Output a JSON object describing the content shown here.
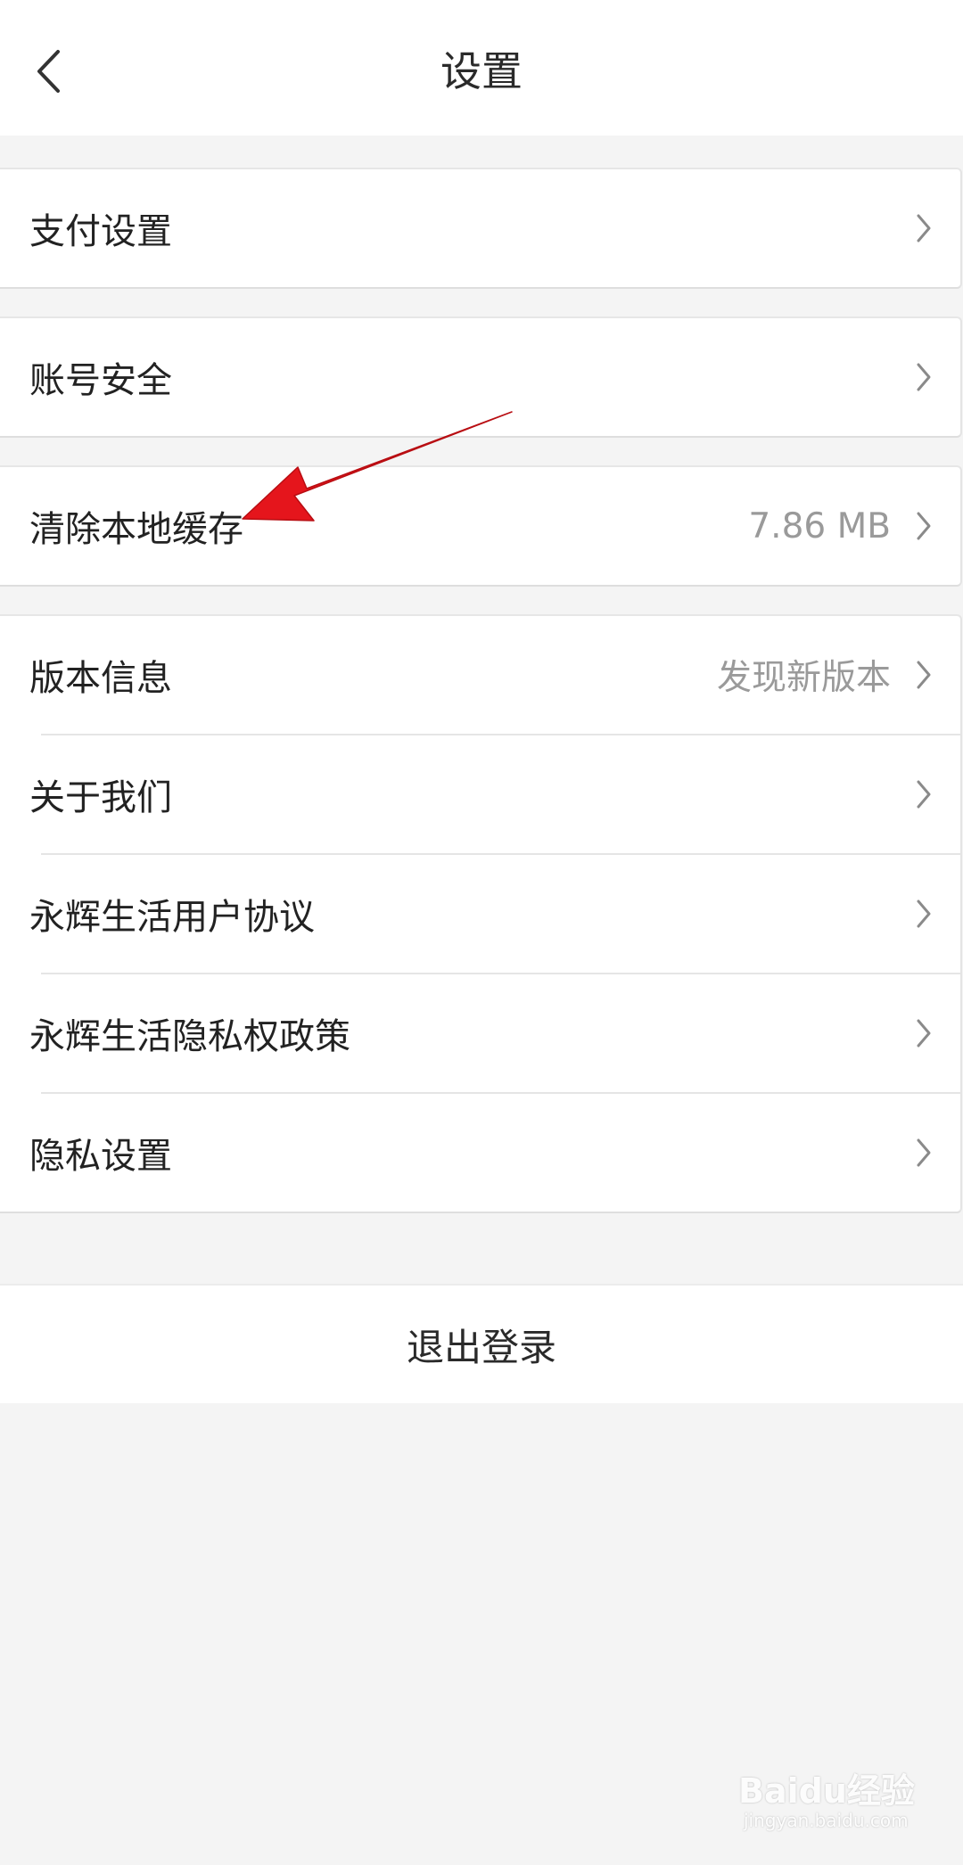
{
  "header": {
    "title": "设置",
    "back_icon": "chevron-left-icon"
  },
  "groups": [
    {
      "items": [
        {
          "label": "支付设置",
          "value": ""
        }
      ]
    },
    {
      "items": [
        {
          "label": "账号安全",
          "value": ""
        }
      ]
    },
    {
      "items": [
        {
          "label": "清除本地缓存",
          "value": "7.86 MB"
        }
      ]
    },
    {
      "items": [
        {
          "label": "版本信息",
          "value": "发现新版本"
        },
        {
          "label": "关于我们",
          "value": ""
        },
        {
          "label": "永辉生活用户协议",
          "value": ""
        },
        {
          "label": "永辉生活隐私权政策",
          "value": ""
        },
        {
          "label": "隐私设置",
          "value": ""
        }
      ]
    }
  ],
  "logout": {
    "label": "退出登录"
  },
  "annotation": {
    "color": "#e5151c"
  },
  "watermark": {
    "brand": "Baidu经验",
    "url": "jingyan.baidu.com"
  },
  "colors": {
    "background": "#f4f4f4",
    "card": "#ffffff",
    "secondary_text": "#9a9a9a",
    "chevron": "#8a8a8a"
  }
}
